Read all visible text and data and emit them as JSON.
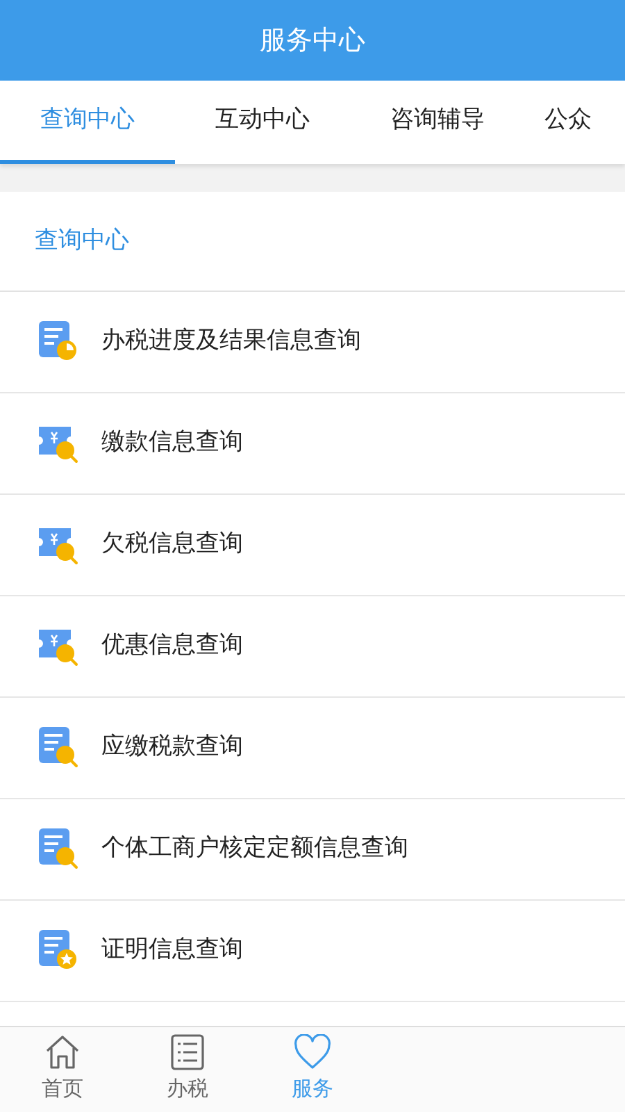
{
  "header": {
    "title": "服务中心"
  },
  "tabs": [
    {
      "label": "查询中心",
      "selected": true
    },
    {
      "label": "互动中心",
      "selected": false
    },
    {
      "label": "咨询辅导",
      "selected": false
    },
    {
      "label": "公众",
      "selected": false
    }
  ],
  "section": {
    "title": "查询中心"
  },
  "items": [
    {
      "label": "办税进度及结果信息查询",
      "kind": "progress"
    },
    {
      "label": "缴款信息查询",
      "kind": "ticket"
    },
    {
      "label": "欠税信息查询",
      "kind": "ticket"
    },
    {
      "label": "优惠信息查询",
      "kind": "ticket"
    },
    {
      "label": "应缴税款查询",
      "kind": "search"
    },
    {
      "label": "个体工商户核定定额信息查询",
      "kind": "search"
    },
    {
      "label": "证明信息查询",
      "kind": "star"
    }
  ],
  "bottom_nav": [
    {
      "label": "首页",
      "kind": "home",
      "selected": false
    },
    {
      "label": "办税",
      "kind": "list",
      "selected": false
    },
    {
      "label": "服务",
      "kind": "heart",
      "selected": true
    }
  ]
}
